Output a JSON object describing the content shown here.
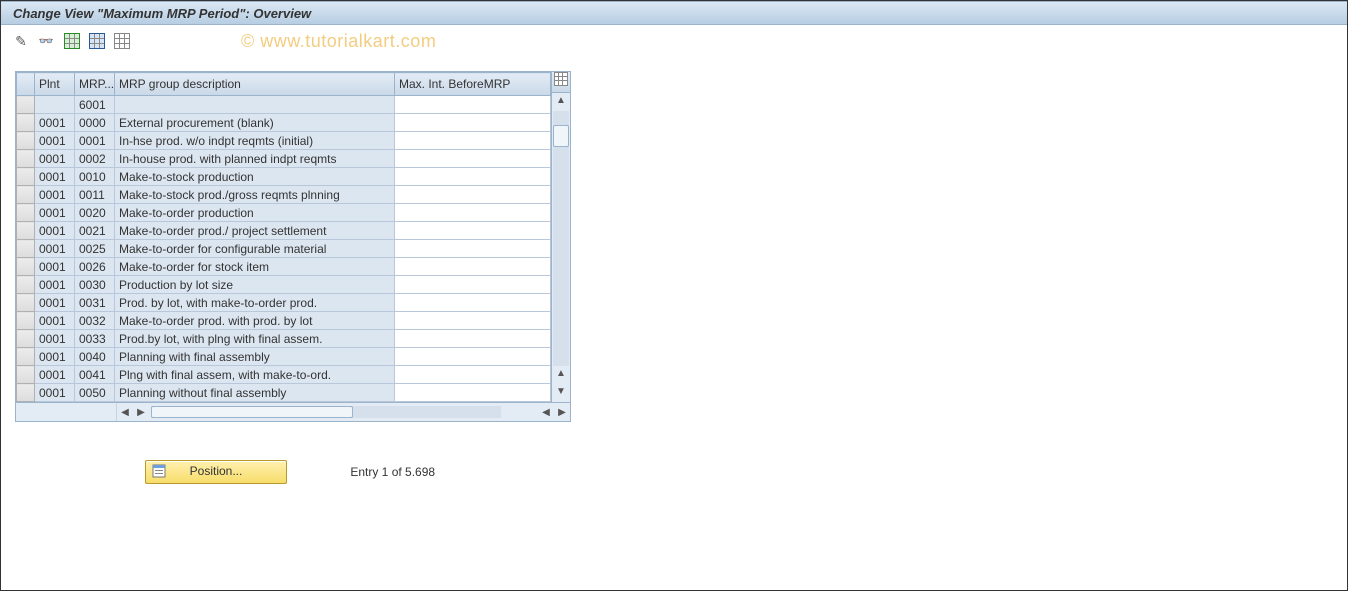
{
  "title": "Change View \"Maximum MRP Period\": Overview",
  "watermark": "© www.tutorialkart.com",
  "columns": {
    "plnt": "Plnt",
    "mrp": "MRP...",
    "desc": "MRP group description",
    "max": "Max. Int. BeforeMRP"
  },
  "rows": [
    {
      "plnt": "",
      "mrp": "6001",
      "desc": "",
      "max": ""
    },
    {
      "plnt": "0001",
      "mrp": "0000",
      "desc": "External procurement            (blank)",
      "max": ""
    },
    {
      "plnt": "0001",
      "mrp": "0001",
      "desc": "In-hse prod. w/o indpt reqmts (initial)",
      "max": ""
    },
    {
      "plnt": "0001",
      "mrp": "0002",
      "desc": "In-house prod. with planned indpt reqmts",
      "max": ""
    },
    {
      "plnt": "0001",
      "mrp": "0010",
      "desc": "Make-to-stock production",
      "max": ""
    },
    {
      "plnt": "0001",
      "mrp": "0011",
      "desc": "Make-to-stock prod./gross reqmts plnning",
      "max": ""
    },
    {
      "plnt": "0001",
      "mrp": "0020",
      "desc": "Make-to-order production",
      "max": ""
    },
    {
      "plnt": "0001",
      "mrp": "0021",
      "desc": "Make-to-order prod./ project settlement",
      "max": ""
    },
    {
      "plnt": "0001",
      "mrp": "0025",
      "desc": "Make-to-order for configurable material",
      "max": ""
    },
    {
      "plnt": "0001",
      "mrp": "0026",
      "desc": "Make-to-order for stock item",
      "max": ""
    },
    {
      "plnt": "0001",
      "mrp": "0030",
      "desc": "Production by lot size",
      "max": ""
    },
    {
      "plnt": "0001",
      "mrp": "0031",
      "desc": "Prod. by lot, with make-to-order prod.",
      "max": ""
    },
    {
      "plnt": "0001",
      "mrp": "0032",
      "desc": "Make-to-order prod. with prod. by lot",
      "max": ""
    },
    {
      "plnt": "0001",
      "mrp": "0033",
      "desc": "Prod.by lot, with plng with final assem.",
      "max": ""
    },
    {
      "plnt": "0001",
      "mrp": "0040",
      "desc": "Planning with final assembly",
      "max": ""
    },
    {
      "plnt": "0001",
      "mrp": "0041",
      "desc": "Plng with final assem, with make-to-ord.",
      "max": ""
    },
    {
      "plnt": "0001",
      "mrp": "0050",
      "desc": "Planning without final assembly",
      "max": ""
    }
  ],
  "footer": {
    "position_button": "Position...",
    "entry_text": "Entry 1 of 5.698"
  }
}
